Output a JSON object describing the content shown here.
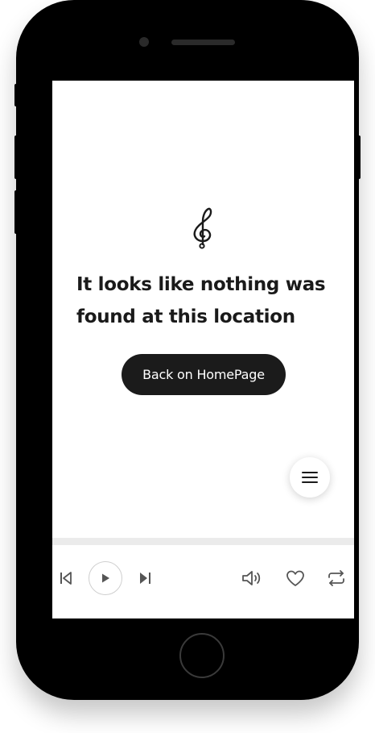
{
  "page": {
    "message": "It looks like nothing was found at this location",
    "back_button_label": "Back on HomePage"
  },
  "icons": {
    "logo": "treble-clef-icon",
    "menu": "hamburger-menu-icon",
    "previous": "skip-previous-icon",
    "play": "play-icon",
    "next": "skip-next-icon",
    "volume": "volume-icon",
    "favorite": "heart-icon",
    "repeat": "repeat-icon"
  },
  "player": {
    "progress_fraction": 0
  },
  "colors": {
    "primary": "#1b1b1b",
    "icon": "#555555",
    "track": "#ebebeb"
  }
}
